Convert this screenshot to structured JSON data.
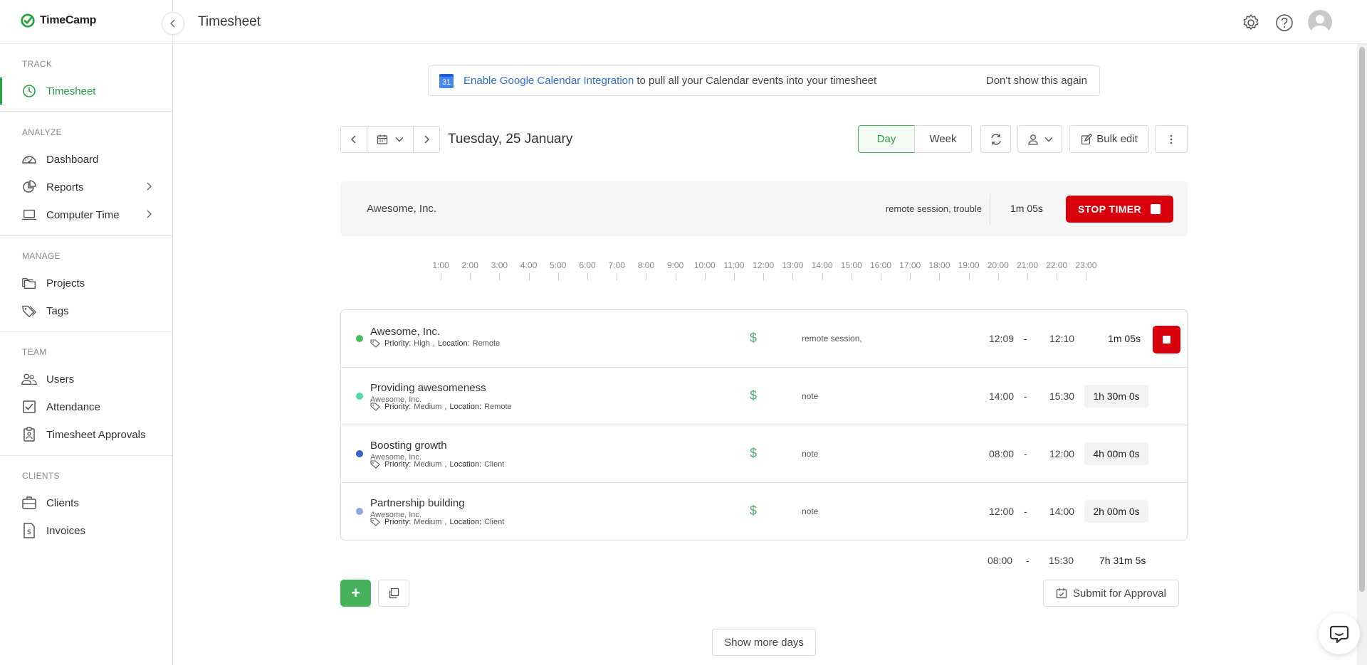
{
  "brand": {
    "name": "TimeCamp",
    "accent": "#25a244"
  },
  "sidebar": {
    "sections": [
      {
        "title": "TRACK",
        "items": [
          {
            "label": "Timesheet",
            "icon": "clock-icon",
            "active": true
          }
        ]
      },
      {
        "title": "ANALYZE",
        "items": [
          {
            "label": "Dashboard",
            "icon": "gauge-icon"
          },
          {
            "label": "Reports",
            "icon": "pie-chart-icon",
            "expandable": true
          },
          {
            "label": "Computer Time",
            "icon": "laptop-icon",
            "expandable": true
          }
        ]
      },
      {
        "title": "MANAGE",
        "items": [
          {
            "label": "Projects",
            "icon": "folders-icon"
          },
          {
            "label": "Tags",
            "icon": "tags-icon"
          }
        ]
      },
      {
        "title": "TEAM",
        "items": [
          {
            "label": "Users",
            "icon": "users-icon"
          },
          {
            "label": "Attendance",
            "icon": "checkbox-icon"
          },
          {
            "label": "Timesheet Approvals",
            "icon": "clipboard-icon"
          }
        ]
      },
      {
        "title": "CLIENTS",
        "items": [
          {
            "label": "Clients",
            "icon": "briefcase-icon"
          },
          {
            "label": "Invoices",
            "icon": "invoice-icon"
          }
        ]
      }
    ]
  },
  "header": {
    "title": "Timesheet"
  },
  "banner": {
    "calendar_day": "31",
    "link": "Enable Google Calendar Integration",
    "text": "to pull all your Calendar events into your timesheet",
    "dismiss": "Don't show this again"
  },
  "toolbar": {
    "date": "Tuesday, 25 January",
    "view_day": "Day",
    "view_week": "Week",
    "active_view": "Day",
    "bulk_edit": "Bulk edit"
  },
  "timer": {
    "project": "Awesome, Inc.",
    "note": "remote session, trouble",
    "duration": "1m 05s",
    "stop_label": "STOP TIMER"
  },
  "timeline": [
    "1:00",
    "2:00",
    "3:00",
    "4:00",
    "5:00",
    "6:00",
    "7:00",
    "8:00",
    "9:00",
    "10:00",
    "11:00",
    "12:00",
    "13:00",
    "14:00",
    "15:00",
    "16:00",
    "17:00",
    "18:00",
    "19:00",
    "20:00",
    "21:00",
    "22:00",
    "23:00"
  ],
  "entries": [
    {
      "title": "Awesome, Inc.",
      "client": "",
      "dot_color": "#3fbf5a",
      "priority": "High",
      "location": "Remote",
      "note": "remote session,",
      "start": "12:09",
      "end": "12:10",
      "duration": "1m 05s",
      "running": true
    },
    {
      "title": "Providing awesomeness",
      "client": "Awesome, Inc.",
      "dot_color": "#4fd8b0",
      "priority": "Medium",
      "location": "Remote",
      "note": "note",
      "start": "14:00",
      "end": "15:30",
      "duration": "1h 30m 0s",
      "running": false
    },
    {
      "title": "Boosting growth",
      "client": "Awesome, Inc.",
      "dot_color": "#3f5fcf",
      "priority": "Medium",
      "location": "Client",
      "note": "note",
      "start": "08:00",
      "end": "12:00",
      "duration": "4h 00m 0s",
      "running": false
    },
    {
      "title": "Partnership building",
      "client": "Awesome, Inc.",
      "dot_color": "#8fa3e0",
      "priority": "Medium",
      "location": "Client",
      "note": "note",
      "start": "12:00",
      "end": "14:00",
      "duration": "2h 00m 0s",
      "running": false
    }
  ],
  "labels": {
    "priority": "Priority:",
    "location": "Location:",
    "dash": "-"
  },
  "summary": {
    "start": "08:00",
    "end": "15:30",
    "total": "7h 31m 5s"
  },
  "actions": {
    "submit": "Submit for Approval",
    "show_more": "Show more days",
    "add": "+"
  }
}
